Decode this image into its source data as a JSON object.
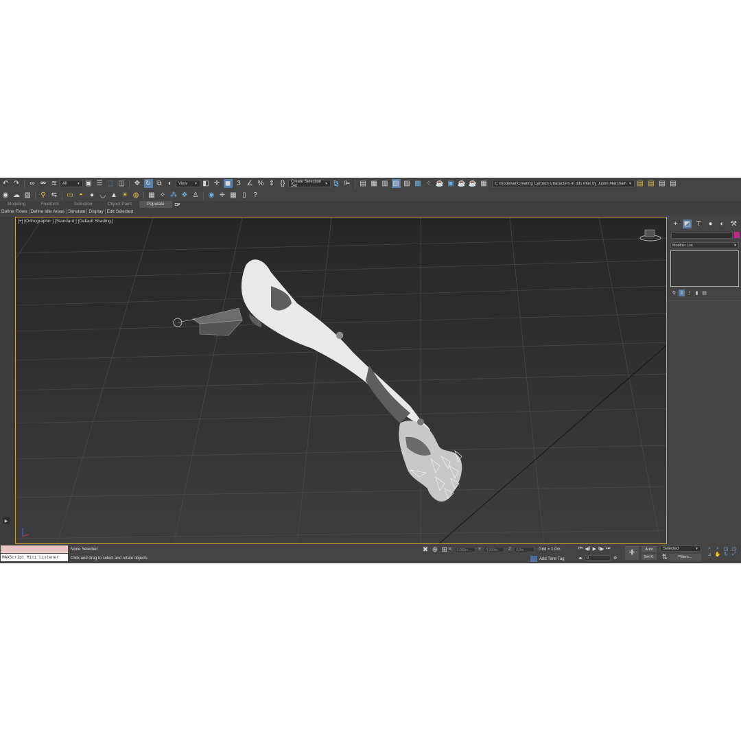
{
  "toolbar": {
    "filter_dropdown": "All",
    "view_dropdown": "View",
    "selection_set": "Create Selection Set",
    "project_path": "E:\\model\\all\\Creating Cartoon Characters in 3ds Max by Justin Marshall\\scenes"
  },
  "ribbon": {
    "tabs": [
      "Modeling",
      "Freeform",
      "Selection",
      "Object Paint",
      "Populate"
    ],
    "active_tab": "Populate",
    "subtabs": [
      "Define Flows",
      "Define Idle Areas",
      "Simulate",
      "Display",
      "Edit Selected"
    ]
  },
  "viewport": {
    "label": "[+] [Orthographic ] [Standard ] [Default Shading ]"
  },
  "command_panel": {
    "modifier_list": "Modifier List",
    "object_color": "#c02a88"
  },
  "status_bar": {
    "maxscript_label": "MAXScript Mini Listener",
    "selection_status": "None Selected",
    "prompt": "Click and drag to select and rotate objects",
    "x_label": "X:",
    "x_value": "0,000m",
    "y_label": "Y:",
    "y_value": "0,000m",
    "z_label": "Z:",
    "z_value": "0,0m",
    "grid": "Grid = 1,0m",
    "add_time_tag": "Add Time Tag",
    "frame_value": "0",
    "auto_label": "Auto",
    "set_key_label": "Set K.",
    "key_filter_dropdown": "Selected",
    "filters_label": "Filters..."
  },
  "colors": {
    "viewport_border": "#c7a43a",
    "accent_blue": "#5c7fa8"
  }
}
